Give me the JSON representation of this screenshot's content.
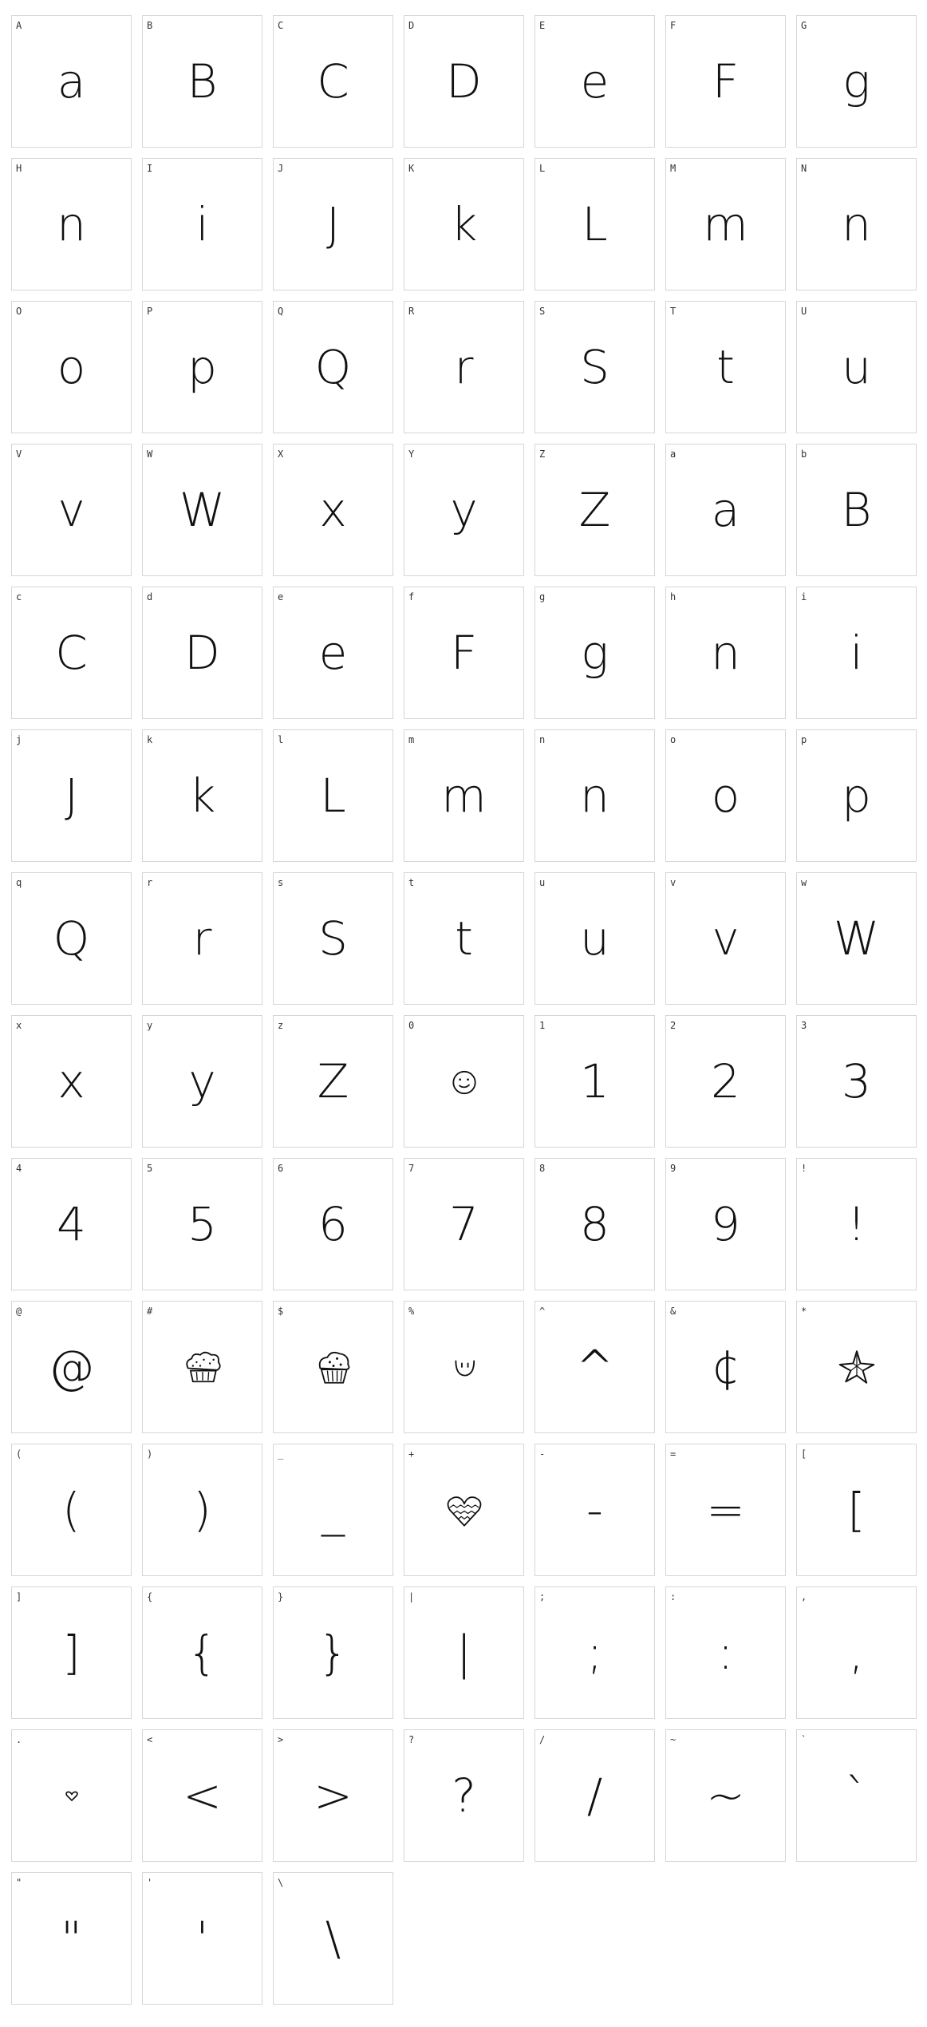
{
  "font_preview": {
    "cells": [
      {
        "label": "A",
        "glyph": "a"
      },
      {
        "label": "B",
        "glyph": "B"
      },
      {
        "label": "C",
        "glyph": "C"
      },
      {
        "label": "D",
        "glyph": "D"
      },
      {
        "label": "E",
        "glyph": "e"
      },
      {
        "label": "F",
        "glyph": "F"
      },
      {
        "label": "G",
        "glyph": "g"
      },
      {
        "label": "H",
        "glyph": "n"
      },
      {
        "label": "I",
        "glyph": "i"
      },
      {
        "label": "J",
        "glyph": "J"
      },
      {
        "label": "K",
        "glyph": "k"
      },
      {
        "label": "L",
        "glyph": "L"
      },
      {
        "label": "M",
        "glyph": "m"
      },
      {
        "label": "N",
        "glyph": "n"
      },
      {
        "label": "O",
        "glyph": "o"
      },
      {
        "label": "P",
        "glyph": "p"
      },
      {
        "label": "Q",
        "glyph": "Q"
      },
      {
        "label": "R",
        "glyph": "r"
      },
      {
        "label": "S",
        "glyph": "S"
      },
      {
        "label": "T",
        "glyph": "t"
      },
      {
        "label": "U",
        "glyph": "u"
      },
      {
        "label": "V",
        "glyph": "v"
      },
      {
        "label": "W",
        "glyph": "W"
      },
      {
        "label": "X",
        "glyph": "x"
      },
      {
        "label": "Y",
        "glyph": "y"
      },
      {
        "label": "Z",
        "glyph": "Z"
      },
      {
        "label": "a",
        "glyph": "a"
      },
      {
        "label": "b",
        "glyph": "B"
      },
      {
        "label": "c",
        "glyph": "C"
      },
      {
        "label": "d",
        "glyph": "D"
      },
      {
        "label": "e",
        "glyph": "e"
      },
      {
        "label": "f",
        "glyph": "F"
      },
      {
        "label": "g",
        "glyph": "g"
      },
      {
        "label": "h",
        "glyph": "n"
      },
      {
        "label": "i",
        "glyph": "i"
      },
      {
        "label": "j",
        "glyph": "J"
      },
      {
        "label": "k",
        "glyph": "k"
      },
      {
        "label": "l",
        "glyph": "L"
      },
      {
        "label": "m",
        "glyph": "m"
      },
      {
        "label": "n",
        "glyph": "n"
      },
      {
        "label": "o",
        "glyph": "o"
      },
      {
        "label": "p",
        "glyph": "p"
      },
      {
        "label": "q",
        "glyph": "Q"
      },
      {
        "label": "r",
        "glyph": "r"
      },
      {
        "label": "s",
        "glyph": "S"
      },
      {
        "label": "t",
        "glyph": "t"
      },
      {
        "label": "u",
        "glyph": "u"
      },
      {
        "label": "v",
        "glyph": "v"
      },
      {
        "label": "w",
        "glyph": "W"
      },
      {
        "label": "x",
        "glyph": "x"
      },
      {
        "label": "y",
        "glyph": "y"
      },
      {
        "label": "z",
        "glyph": "Z"
      },
      {
        "label": "0",
        "icon": "smiley-face-icon"
      },
      {
        "label": "1",
        "glyph": "1"
      },
      {
        "label": "2",
        "glyph": "2"
      },
      {
        "label": "3",
        "glyph": "3"
      },
      {
        "label": "4",
        "glyph": "4"
      },
      {
        "label": "5",
        "glyph": "5"
      },
      {
        "label": "6",
        "glyph": "6"
      },
      {
        "label": "7",
        "glyph": "7"
      },
      {
        "label": "8",
        "glyph": "8"
      },
      {
        "label": "9",
        "glyph": "9"
      },
      {
        "label": "!",
        "glyph": "!"
      },
      {
        "label": "@",
        "glyph": "@"
      },
      {
        "label": "#",
        "icon": "muffin-icon"
      },
      {
        "label": "$",
        "icon": "cupcake-icon"
      },
      {
        "label": "%",
        "icon": "smile-icon"
      },
      {
        "label": "^",
        "glyph": "^"
      },
      {
        "label": "&",
        "glyph": "¢"
      },
      {
        "label": "*",
        "icon": "star-doodle-icon"
      },
      {
        "label": "(",
        "glyph": "("
      },
      {
        "label": ")",
        "glyph": ")"
      },
      {
        "label": "_",
        "glyph": "_"
      },
      {
        "label": "+",
        "icon": "patterned-heart-icon"
      },
      {
        "label": "-",
        "glyph": "-"
      },
      {
        "label": "=",
        "glyph": "="
      },
      {
        "label": "[",
        "glyph": "["
      },
      {
        "label": "]",
        "glyph": "]"
      },
      {
        "label": "{",
        "glyph": "{"
      },
      {
        "label": "}",
        "glyph": "}"
      },
      {
        "label": "|",
        "glyph": "|"
      },
      {
        "label": ";",
        "glyph": ";"
      },
      {
        "label": ":",
        "glyph": ":"
      },
      {
        "label": ",",
        "glyph": ","
      },
      {
        "label": ".",
        "icon": "small-heart-icon"
      },
      {
        "label": "<",
        "glyph": "<"
      },
      {
        "label": ">",
        "glyph": ">"
      },
      {
        "label": "?",
        "glyph": "?"
      },
      {
        "label": "/",
        "glyph": "/"
      },
      {
        "label": "~",
        "glyph": "~"
      },
      {
        "label": "`",
        "glyph": "`"
      },
      {
        "label": "\"",
        "glyph": "\""
      },
      {
        "label": "'",
        "glyph": "'"
      },
      {
        "label": "\\",
        "glyph": "\\"
      }
    ]
  }
}
